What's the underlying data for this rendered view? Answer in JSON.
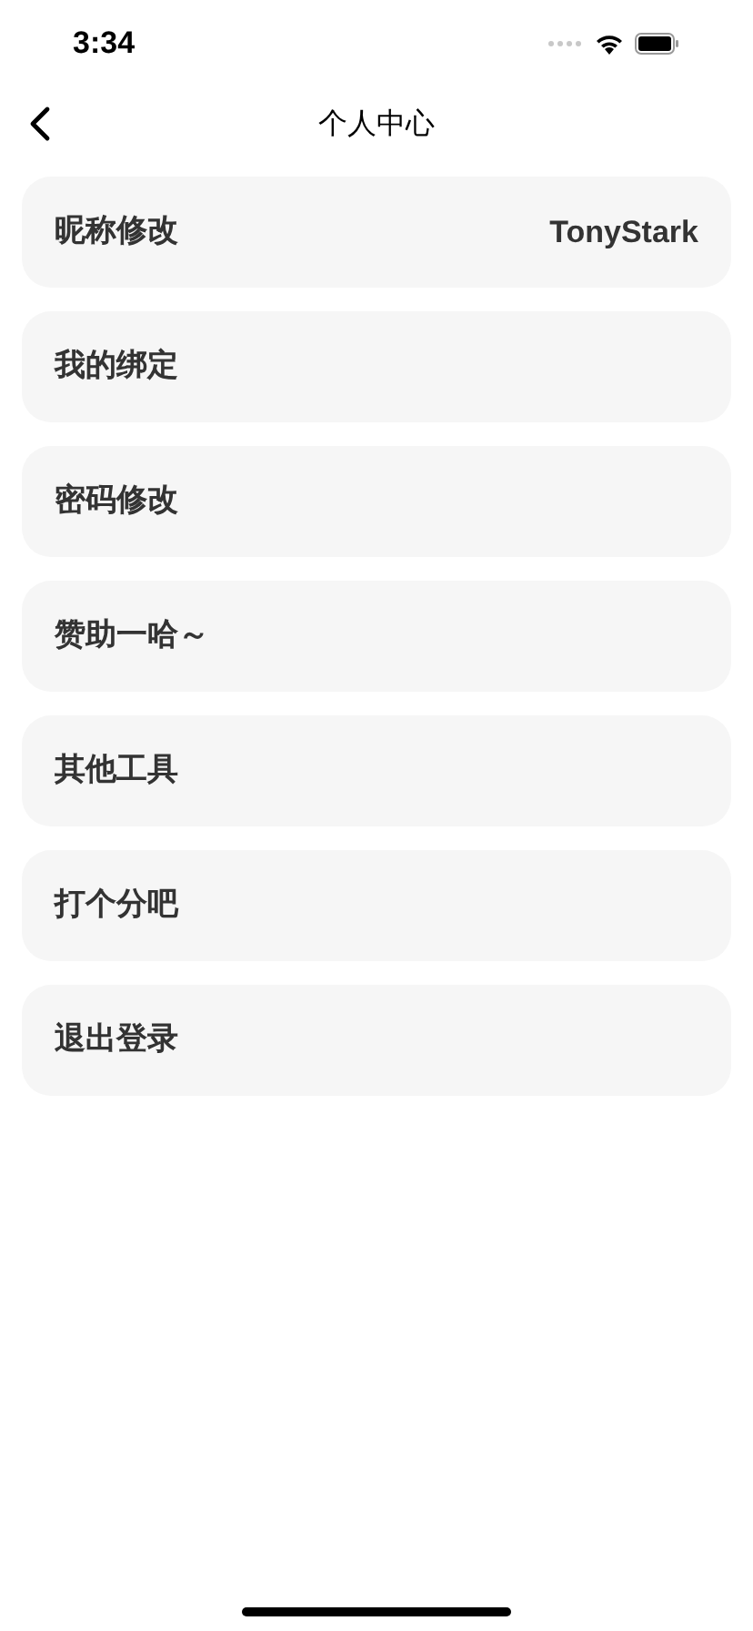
{
  "status_bar": {
    "time": "3:34"
  },
  "nav": {
    "title": "个人中心"
  },
  "items": [
    {
      "label": "昵称修改",
      "value": "TonyStark"
    },
    {
      "label": "我的绑定"
    },
    {
      "label": "密码修改"
    },
    {
      "label": "赞助一哈～"
    },
    {
      "label": "其他工具"
    },
    {
      "label": "打个分吧"
    },
    {
      "label": "退出登录"
    }
  ]
}
